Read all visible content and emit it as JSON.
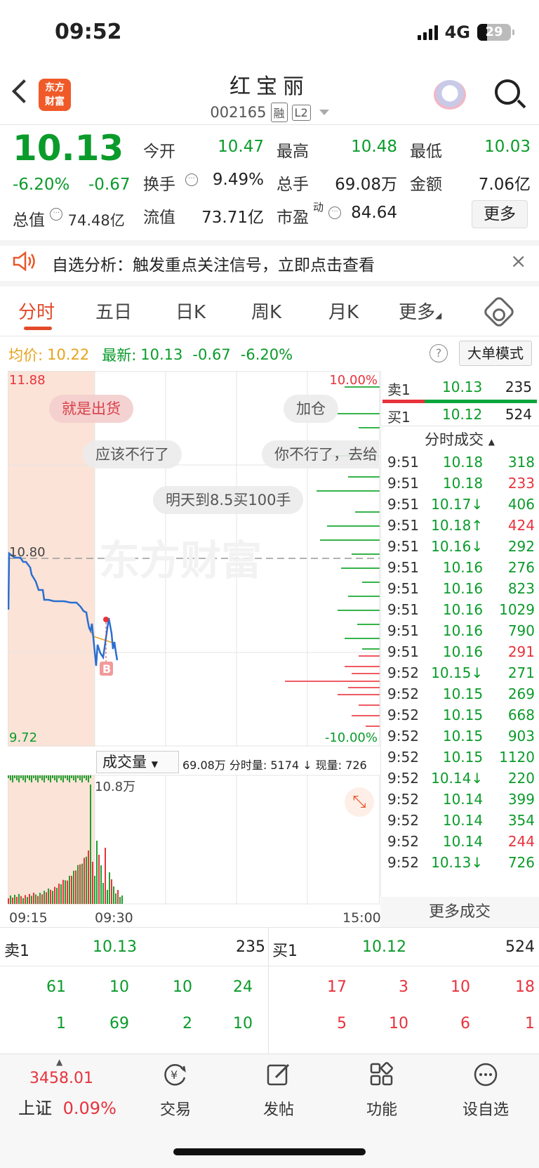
{
  "status_bar": {
    "time": "09:52",
    "network": "4G",
    "battery": "29"
  },
  "header": {
    "stock_name": "红宝丽",
    "stock_code": "002165",
    "tag_margin": "融",
    "tag_level": "L2",
    "logo_line1": "东方",
    "logo_line2": "财富"
  },
  "quote": {
    "last": "10.13",
    "change_pct": "-6.20%",
    "change_amt": "-0.67",
    "market_cap_label": "总值",
    "market_cap": "74.48亿",
    "open_label": "今开",
    "open": "10.47",
    "high_label": "最高",
    "high": "10.48",
    "low_label": "最低",
    "low": "10.03",
    "turnover_label": "换手",
    "turnover": "9.49%",
    "volume_label": "总手",
    "volume": "69.08万",
    "amount_label": "金额",
    "amount": "7.06亿",
    "float_label": "流值",
    "float_cap": "73.71亿",
    "pe_label": "市盈",
    "pe_sup": "动",
    "pe": "84.64",
    "more": "更多"
  },
  "notice": {
    "text": "自选分析：触发重点关注信号，立即点击查看",
    "close": "×"
  },
  "tabs": [
    "分时",
    "五日",
    "日K",
    "周K",
    "月K",
    "更多"
  ],
  "avg_row": {
    "avg_label": "均价:",
    "avg": "10.22",
    "last_label": "最新:",
    "last": "10.13",
    "chg": "-0.67",
    "pct": "-6.20%",
    "help": "?",
    "big_order": "大单模式"
  },
  "price_chart": {
    "top_price": "11.88",
    "bottom_price": "9.72",
    "ref_price": "10.80",
    "top_pct": "10.00%",
    "bottom_pct": "-10.00%",
    "watermark": "东方财富",
    "buy_marker": "B"
  },
  "danmu": [
    "就是出货",
    "加仓",
    "应该不行了",
    "你不行了，去给",
    "明天到8.5买100手"
  ],
  "volume_chart": {
    "selector": "成交量",
    "summary": "69.08万 分时量: 5174 ↓ 现量: 726",
    "max_label": "10.8万",
    "t_start": "09:15",
    "t_mid": "09:30",
    "t_end": "15:00"
  },
  "order_book_side": {
    "sell_label": "卖1",
    "sell_price": "10.13",
    "sell_vol": "235",
    "buy_label": "买1",
    "buy_price": "10.12",
    "buy_vol": "524"
  },
  "ticks_header": "分时成交",
  "ticks": [
    {
      "t": "9:51",
      "p": "10.18",
      "v": "318",
      "pc": "green",
      "vc": "green"
    },
    {
      "t": "9:51",
      "p": "10.18",
      "v": "233",
      "pc": "green",
      "vc": "red"
    },
    {
      "t": "9:51",
      "p": "10.17↓",
      "v": "406",
      "pc": "green",
      "vc": "green"
    },
    {
      "t": "9:51",
      "p": "10.18↑",
      "v": "424",
      "pc": "green",
      "vc": "red"
    },
    {
      "t": "9:51",
      "p": "10.16↓",
      "v": "292",
      "pc": "green",
      "vc": "green"
    },
    {
      "t": "9:51",
      "p": "10.16",
      "v": "276",
      "pc": "green",
      "vc": "green"
    },
    {
      "t": "9:51",
      "p": "10.16",
      "v": "823",
      "pc": "green",
      "vc": "green"
    },
    {
      "t": "9:51",
      "p": "10.16",
      "v": "1029",
      "pc": "green",
      "vc": "green"
    },
    {
      "t": "9:51",
      "p": "10.16",
      "v": "790",
      "pc": "green",
      "vc": "green"
    },
    {
      "t": "9:51",
      "p": "10.16",
      "v": "291",
      "pc": "green",
      "vc": "red"
    },
    {
      "t": "9:52",
      "p": "10.15↓",
      "v": "271",
      "pc": "green",
      "vc": "green"
    },
    {
      "t": "9:52",
      "p": "10.15",
      "v": "269",
      "pc": "green",
      "vc": "green"
    },
    {
      "t": "9:52",
      "p": "10.15",
      "v": "668",
      "pc": "green",
      "vc": "green"
    },
    {
      "t": "9:52",
      "p": "10.15",
      "v": "903",
      "pc": "green",
      "vc": "green"
    },
    {
      "t": "9:52",
      "p": "10.15",
      "v": "1120",
      "pc": "green",
      "vc": "green"
    },
    {
      "t": "9:52",
      "p": "10.14↓",
      "v": "220",
      "pc": "green",
      "vc": "green"
    },
    {
      "t": "9:52",
      "p": "10.14",
      "v": "399",
      "pc": "green",
      "vc": "green"
    },
    {
      "t": "9:52",
      "p": "10.14",
      "v": "354",
      "pc": "green",
      "vc": "green"
    },
    {
      "t": "9:52",
      "p": "10.14",
      "v": "244",
      "pc": "green",
      "vc": "red"
    },
    {
      "t": "9:52",
      "p": "10.13↓",
      "v": "726",
      "pc": "green",
      "vc": "green"
    }
  ],
  "more_trades": "更多成交",
  "bottom_book": {
    "sell_label": "卖1",
    "sell_price": "10.13",
    "sell_vol": "235",
    "buy_label": "买1",
    "buy_price": "10.12",
    "buy_vol": "524",
    "sell_rows": [
      [
        "61",
        "10",
        "10",
        "24"
      ],
      [
        "1",
        "69",
        "2",
        "10"
      ]
    ],
    "buy_rows": [
      [
        "17",
        "3",
        "10",
        "18"
      ],
      [
        "5",
        "10",
        "6",
        "1"
      ]
    ]
  },
  "bottom_nav": {
    "index_value": "3458.01",
    "index_name": "上证",
    "index_pct": "0.09%",
    "trade": "交易",
    "post": "发帖",
    "functions": "功能",
    "add_watch": "设自选"
  },
  "colors": {
    "up": "#e8323c",
    "down": "#0a9b2a",
    "accent": "#e24a2a",
    "avg_line": "#e6a41d",
    "price_line": "#2a6fd0"
  }
}
